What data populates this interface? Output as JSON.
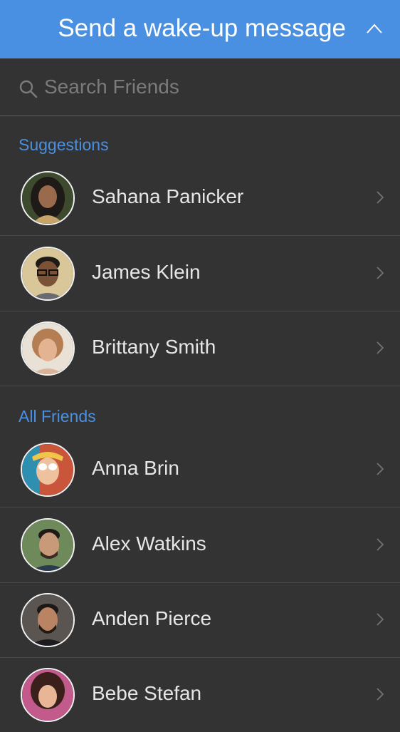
{
  "header": {
    "title": "Send a wake-up message",
    "toggle_icon": "chevron-up-icon",
    "background_color": "#4a90e2"
  },
  "search": {
    "placeholder": "Search Friends",
    "value": "",
    "icon": "search-icon"
  },
  "sections": {
    "suggestions": {
      "title": "Suggestions",
      "friends": [
        {
          "name": "Sahana Panicker",
          "avatar": "avatar-photo"
        },
        {
          "name": "James Klein",
          "avatar": "avatar-photo"
        },
        {
          "name": "Brittany Smith",
          "avatar": "avatar-photo"
        }
      ]
    },
    "all_friends": {
      "title": "All Friends",
      "friends": [
        {
          "name": "Anna Brin",
          "avatar": "avatar-photo"
        },
        {
          "name": "Alex Watkins",
          "avatar": "avatar-photo"
        },
        {
          "name": "Anden Pierce",
          "avatar": "avatar-photo"
        },
        {
          "name": "Bebe Stefan",
          "avatar": "avatar-photo"
        }
      ]
    }
  },
  "colors": {
    "accent": "#4a90e2",
    "background": "#333333",
    "text": "#e6e6e6"
  }
}
